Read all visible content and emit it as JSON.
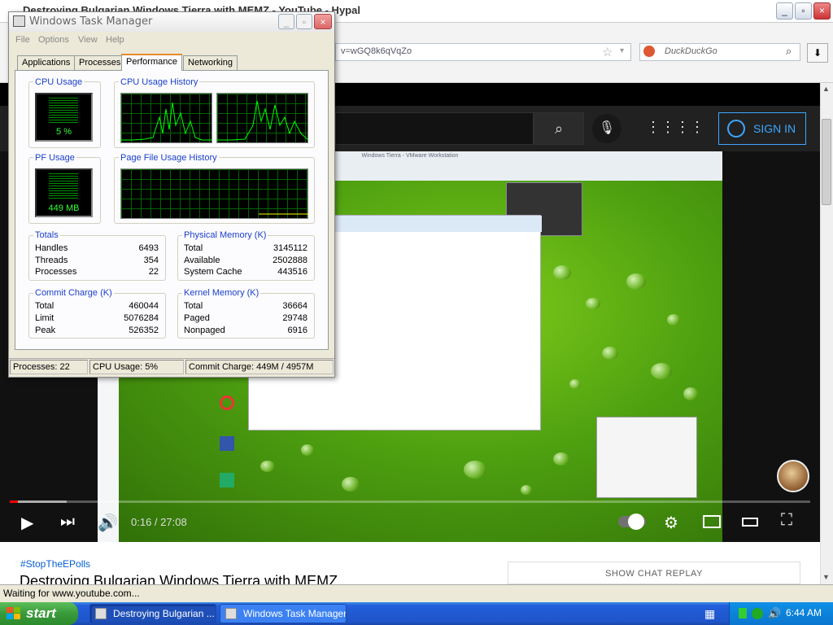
{
  "browser": {
    "title": "Destroying Bulgarian Windows Tierra with MEMZ - YouTube - Hypal",
    "url": "v=wGQ8k6qVqZo",
    "search_placeholder": "DuckDuckGo",
    "status": "Waiting for www.youtube.com..."
  },
  "youtube": {
    "sign_in": "SIGN IN",
    "time": "0:16 / 27:08",
    "progress": 0.01,
    "hashtag": "#StopTheEPolls",
    "video_title": "Destroying Bulgarian Windows Tierra with MEMZ",
    "chat_replay": "SHOW CHAT REPLAY",
    "vm_title": "Windows Tierra - VMware Workstation"
  },
  "task_manager": {
    "title": "Windows Task Manager",
    "menu": [
      "File",
      "Options",
      "View",
      "Help"
    ],
    "tabs": [
      "Applications",
      "Processes",
      "Performance",
      "Networking"
    ],
    "active_tab": "Performance",
    "cpu_usage_label": "CPU Usage",
    "cpu_usage_value": "5 %",
    "cpu_history_label": "CPU Usage History",
    "pf_usage_label": "PF Usage",
    "pf_usage_value": "449 MB",
    "pf_history_label": "Page File Usage History",
    "totals": {
      "label": "Totals",
      "rows": [
        {
          "name": "Handles",
          "value": "6493"
        },
        {
          "name": "Threads",
          "value": "354"
        },
        {
          "name": "Processes",
          "value": "22"
        }
      ]
    },
    "physical_memory": {
      "label": "Physical Memory (K)",
      "rows": [
        {
          "name": "Total",
          "value": "3145112"
        },
        {
          "name": "Available",
          "value": "2502888"
        },
        {
          "name": "System Cache",
          "value": "443516"
        }
      ]
    },
    "commit_charge": {
      "label": "Commit Charge (K)",
      "rows": [
        {
          "name": "Total",
          "value": "460044"
        },
        {
          "name": "Limit",
          "value": "5076284"
        },
        {
          "name": "Peak",
          "value": "526352"
        }
      ]
    },
    "kernel_memory": {
      "label": "Kernel Memory (K)",
      "rows": [
        {
          "name": "Total",
          "value": "36664"
        },
        {
          "name": "Paged",
          "value": "29748"
        },
        {
          "name": "Nonpaged",
          "value": "6916"
        }
      ]
    },
    "status": {
      "processes": "Processes: 22",
      "cpu": "CPU Usage: 5%",
      "commit": "Commit Charge: 449M / 4957M"
    }
  },
  "taskbar": {
    "start": "start",
    "tasks": [
      "Destroying Bulgarian ...",
      "Windows Task Manager"
    ],
    "clock": "6:44 AM"
  },
  "colors": {
    "xp_blue": "#245edb",
    "start_green": "#3a9a3a",
    "graph_green": "#00ff00",
    "yt_red": "#ff0000",
    "yt_blue": "#3ea6ff"
  }
}
